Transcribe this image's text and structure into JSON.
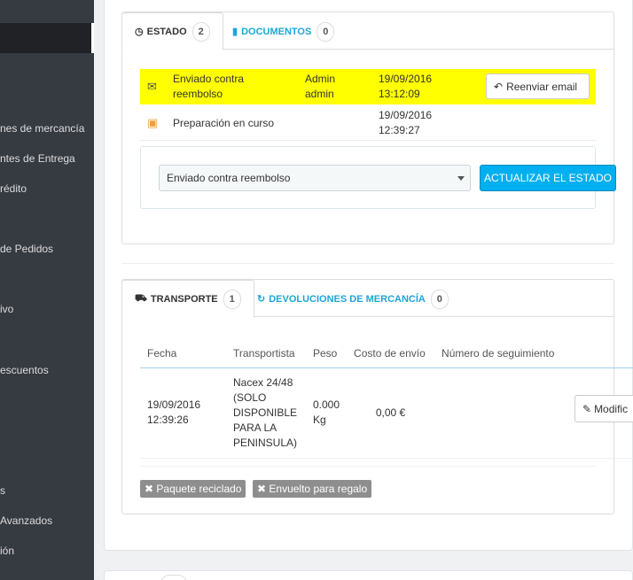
{
  "sidebar": {
    "items": [
      "nes de mercancía",
      "ntes de Entrega",
      "rédito",
      "de Pedidos",
      "ivo",
      "escuentos",
      "s",
      "Avanzados",
      "ión"
    ]
  },
  "status_tabs": [
    {
      "icon": "clock-icon",
      "label": "Estado",
      "count": "2"
    },
    {
      "icon": "file-icon",
      "label": "Documentos",
      "count": "0"
    }
  ],
  "history": [
    {
      "icon": "envelope-icon",
      "state": "Enviado contra reembolso",
      "employee": "Admin admin",
      "date": "19/09/2016 13:12:09",
      "action": "Reenviar email"
    },
    {
      "icon": "package-icon",
      "state": "Preparación en curso",
      "employee": "",
      "date": "19/09/2016 12:39:27",
      "action": ""
    }
  ],
  "status_form": {
    "selected": "Enviado contra reembolso",
    "button": "Actualizar el estado"
  },
  "shipping_tabs": [
    {
      "icon": "truck-icon",
      "label": "Transporte",
      "count": "1"
    },
    {
      "icon": "undo-icon",
      "label": "Devoluciones de mercancía",
      "count": "0"
    }
  ],
  "shipping_table": {
    "headers": [
      "Fecha",
      "Transportista",
      "Peso",
      "Costo de envío",
      "Número de seguimiento"
    ],
    "rows": [
      {
        "date": "19/09/2016 12:39:26",
        "carrier": "Nacex 24/48 (SOLO DISPONIBLE PARA LA PENINSULA)",
        "weight": "0.000 Kg",
        "cost": "0,00 €",
        "tracking": "",
        "action": "Modific"
      }
    ]
  },
  "tags": [
    "Paquete reciclado",
    "Envuelto para regalo"
  ],
  "colors": {
    "accent": "#00aff0",
    "highlight": "#ffff00",
    "sidebar": "#363a41"
  }
}
